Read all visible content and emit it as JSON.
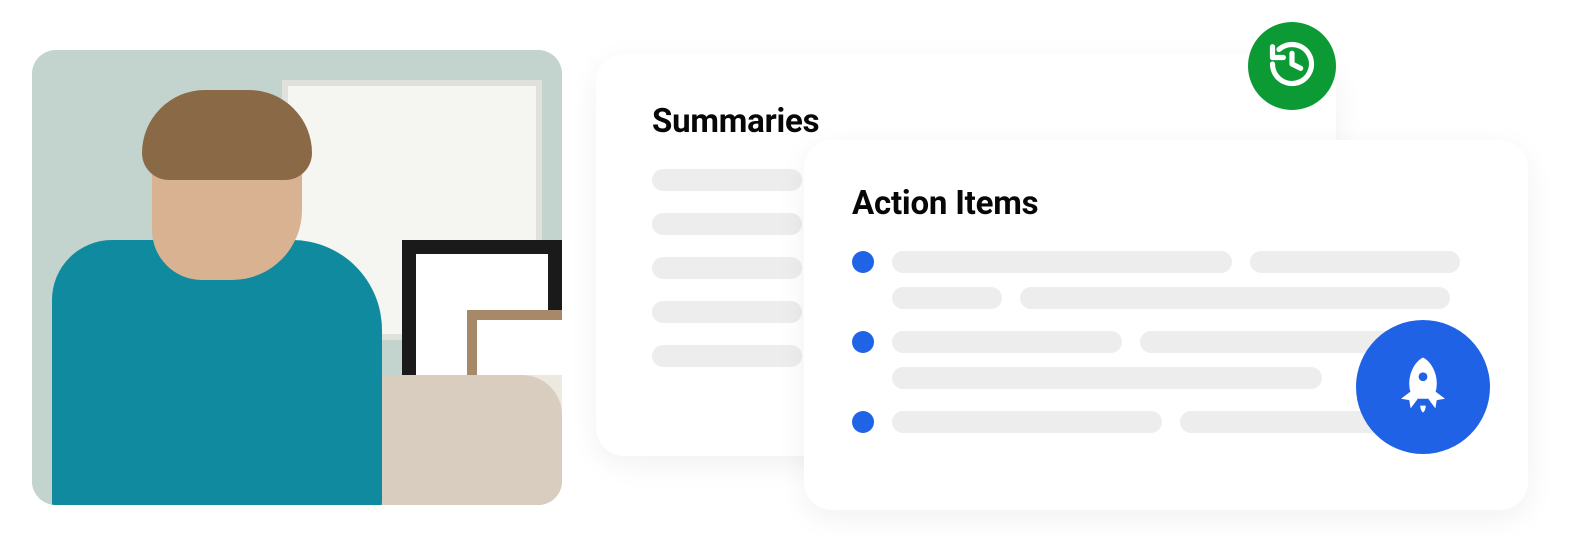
{
  "summaries": {
    "title": "Summaries"
  },
  "action_items": {
    "title": "Action Items"
  },
  "colors": {
    "accent_blue": "#2062e6",
    "accent_green": "#0b9a34",
    "skeleton": "#ededed"
  },
  "icons": {
    "history": "history-icon",
    "rocket": "rocket-icon"
  }
}
